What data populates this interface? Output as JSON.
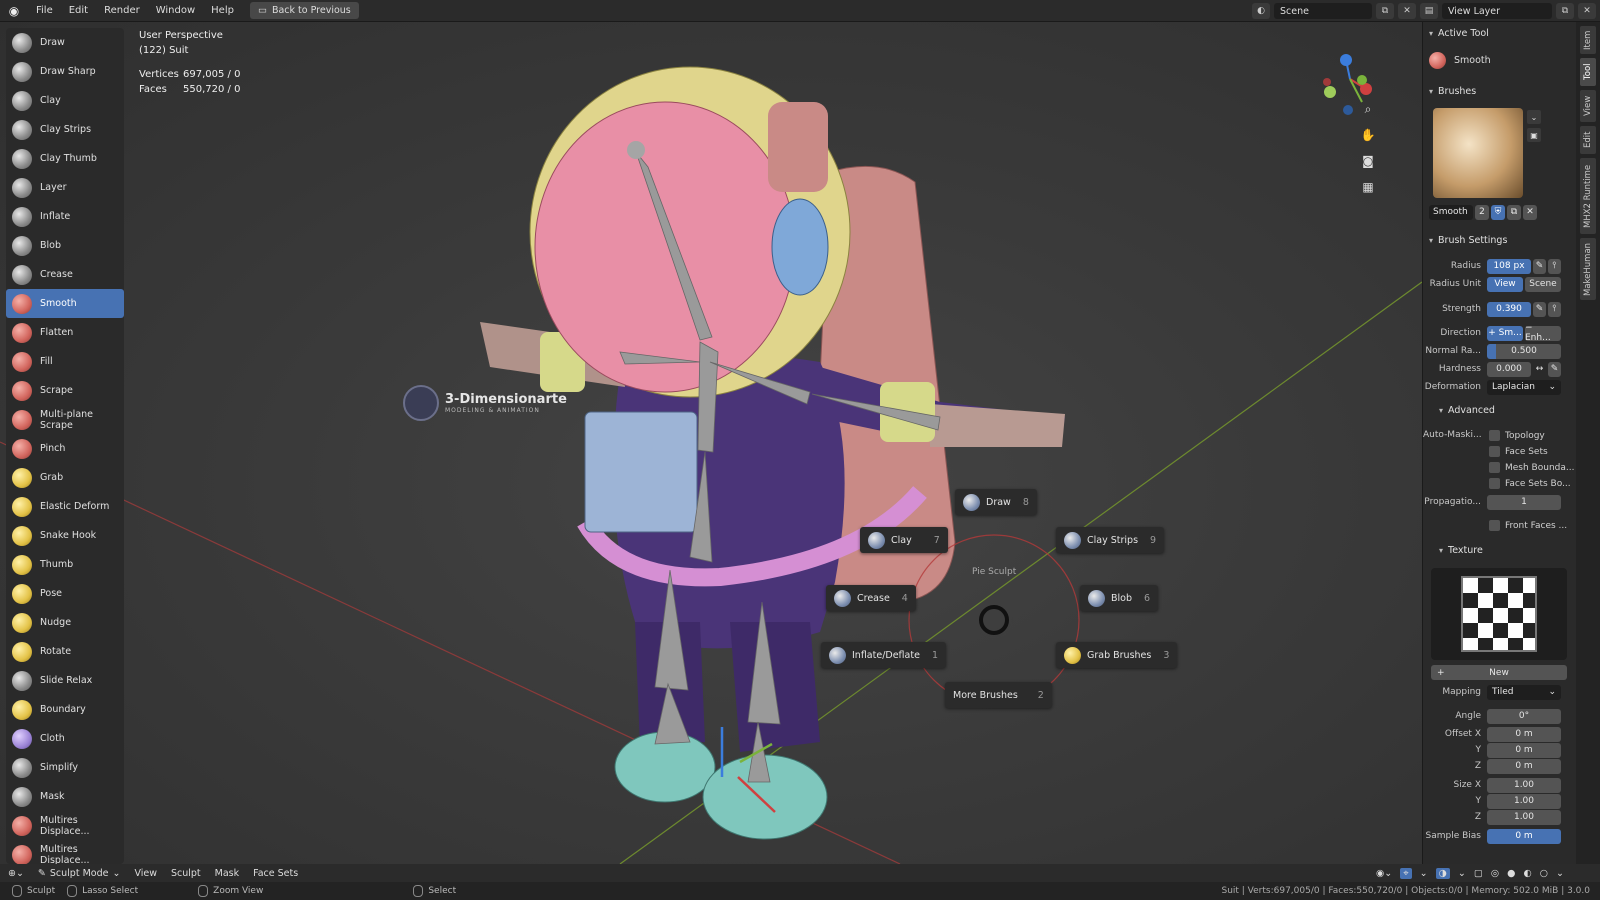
{
  "topbar": {
    "menus": [
      "File",
      "Edit",
      "Render",
      "Window",
      "Help"
    ],
    "back_button": "Back to Previous",
    "scene_name": "Scene",
    "view_layer": "View Layer"
  },
  "viewport": {
    "perspective": "User Perspective",
    "object": "(122) Suit",
    "vertices_label": "Vertices",
    "vertices_value": "697,005 / 0",
    "faces_label": "Faces",
    "faces_value": "550,720 / 0",
    "watermark": "3-Dimensionarte",
    "watermark_sub": "MODELING & ANIMATION"
  },
  "tools": [
    {
      "label": "Draw",
      "icon": "draw-brush-icon",
      "tint": "grey"
    },
    {
      "label": "Draw Sharp",
      "icon": "draw-sharp-brush-icon",
      "tint": "grey"
    },
    {
      "label": "Clay",
      "icon": "clay-brush-icon",
      "tint": "grey"
    },
    {
      "label": "Clay Strips",
      "icon": "clay-strips-brush-icon",
      "tint": "grey"
    },
    {
      "label": "Clay Thumb",
      "icon": "clay-thumb-brush-icon",
      "tint": "grey"
    },
    {
      "label": "Layer",
      "icon": "layer-brush-icon",
      "tint": "grey"
    },
    {
      "label": "Inflate",
      "icon": "inflate-brush-icon",
      "tint": "grey"
    },
    {
      "label": "Blob",
      "icon": "blob-brush-icon",
      "tint": "grey"
    },
    {
      "label": "Crease",
      "icon": "crease-brush-icon",
      "tint": "grey"
    },
    {
      "label": "Smooth",
      "icon": "smooth-brush-icon",
      "tint": "red",
      "active": true
    },
    {
      "label": "Flatten",
      "icon": "flatten-brush-icon",
      "tint": "red"
    },
    {
      "label": "Fill",
      "icon": "fill-brush-icon",
      "tint": "red"
    },
    {
      "label": "Scrape",
      "icon": "scrape-brush-icon",
      "tint": "red"
    },
    {
      "label": "Multi-plane Scrape",
      "icon": "multiplane-scrape-brush-icon",
      "tint": "red"
    },
    {
      "label": "Pinch",
      "icon": "pinch-brush-icon",
      "tint": "red"
    },
    {
      "label": "Grab",
      "icon": "grab-brush-icon",
      "tint": "yel"
    },
    {
      "label": "Elastic Deform",
      "icon": "elastic-deform-brush-icon",
      "tint": "yel"
    },
    {
      "label": "Snake Hook",
      "icon": "snake-hook-brush-icon",
      "tint": "yel"
    },
    {
      "label": "Thumb",
      "icon": "thumb-brush-icon",
      "tint": "yel"
    },
    {
      "label": "Pose",
      "icon": "pose-brush-icon",
      "tint": "yel"
    },
    {
      "label": "Nudge",
      "icon": "nudge-brush-icon",
      "tint": "yel"
    },
    {
      "label": "Rotate",
      "icon": "rotate-brush-icon",
      "tint": "yel"
    },
    {
      "label": "Slide Relax",
      "icon": "slide-relax-brush-icon",
      "tint": "grey"
    },
    {
      "label": "Boundary",
      "icon": "boundary-brush-icon",
      "tint": "yel"
    },
    {
      "label": "Cloth",
      "icon": "cloth-brush-icon",
      "tint": "pur"
    },
    {
      "label": "Simplify",
      "icon": "simplify-brush-icon",
      "tint": "grey"
    },
    {
      "label": "Mask",
      "icon": "mask-brush-icon",
      "tint": "grey"
    },
    {
      "label": "Multires Displace...",
      "icon": "multires-displace-brush-icon",
      "tint": "red"
    },
    {
      "label": "Multires Displace...",
      "icon": "multires-displace-smear-brush-icon",
      "tint": "red"
    }
  ],
  "pie_menu": {
    "title": "Pie Sculpt",
    "items": [
      {
        "label": "Draw",
        "key": "8"
      },
      {
        "label": "Clay",
        "key": "7"
      },
      {
        "label": "Clay Strips",
        "key": "9"
      },
      {
        "label": "Crease",
        "key": "4"
      },
      {
        "label": "Blob",
        "key": "6"
      },
      {
        "label": "Inflate/Deflate",
        "key": "1"
      },
      {
        "label": "Grab Brushes",
        "key": "3"
      },
      {
        "label": "More Brushes",
        "key": "2"
      }
    ]
  },
  "right_panel": {
    "active_tool_header": "Active Tool",
    "active_tool": "Smooth",
    "brushes_header": "Brushes",
    "brush_name": "Smooth",
    "brush_users": "2",
    "brush_settings_header": "Brush Settings",
    "radius_label": "Radius",
    "radius_value": "108 px",
    "radius_unit_label": "Radius Unit",
    "radius_unit_view": "View",
    "radius_unit_scene": "Scene",
    "strength_label": "Strength",
    "strength_value": "0.390",
    "direction_label": "Direction",
    "direction_smooth": "+ Sm...",
    "direction_enhance": "− Enh...",
    "normal_radius_label": "Normal Ra...",
    "normal_radius_value": "0.500",
    "hardness_label": "Hardness",
    "hardness_value": "0.000",
    "deformation_label": "Deformation",
    "deformation_value": "Laplacian",
    "advanced_header": "Advanced",
    "automask_label": "Auto-Maski...",
    "automask_options": [
      "Topology",
      "Face Sets",
      "Mesh Bounda...",
      "Face Sets Bo..."
    ],
    "propagation_label": "Propagatio...",
    "propagation_value": "1",
    "front_faces": "Front Faces ...",
    "texture_header": "Texture",
    "new_button": "New",
    "mapping_label": "Mapping",
    "mapping_value": "Tiled",
    "angle_label": "Angle",
    "angle_value": "0°",
    "offset_x_label": "Offset X",
    "offset_x_value": "0 m",
    "y_label": "Y",
    "offset_y_value": "0 m",
    "z_label": "Z",
    "offset_z_value": "0 m",
    "size_x_label": "Size X",
    "size_x_value": "1.00",
    "size_y_value": "1.00",
    "size_z_value": "1.00",
    "sample_bias_label": "Sample Bias",
    "sample_bias_value": "0 m"
  },
  "side_tabs": [
    "Item",
    "Tool",
    "View",
    "Edit",
    "MHX2 Runtime",
    "MakeHuman"
  ],
  "header_bar": {
    "mode": "Sculpt Mode",
    "menus": [
      "View",
      "Sculpt",
      "Mask",
      "Face Sets"
    ]
  },
  "status_bar": {
    "sculpt": "Sculpt",
    "lasso": "Lasso Select",
    "zoom": "Zoom View",
    "select": "Select",
    "info": "Suit | Verts:697,005/0 | Faces:550,720/0 | Objects:0/0 | Memory: 502.0 MiB | 3.0.0"
  },
  "colors": {
    "accent": "#4772b3",
    "panel": "#2a2a2a",
    "viewport": "#3a3a3a",
    "helmet": "#e88fa6",
    "suit": "#4a3478"
  }
}
